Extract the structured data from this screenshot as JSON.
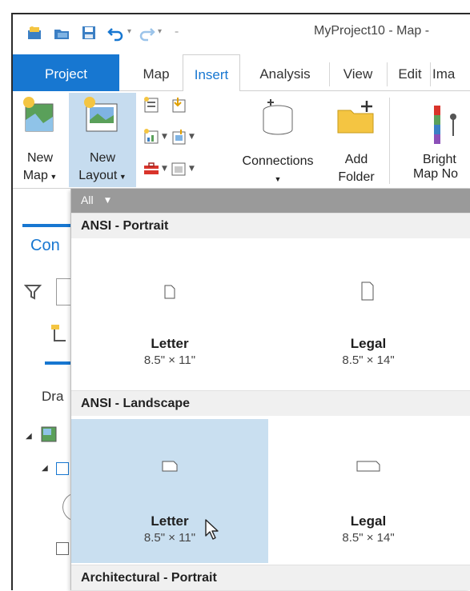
{
  "window": {
    "title": "MyProject10 - Map -"
  },
  "tabs": [
    {
      "label": "Project"
    },
    {
      "label": "Map"
    },
    {
      "label": "Insert"
    },
    {
      "label": "Analysis"
    },
    {
      "label": "View"
    },
    {
      "label": "Edit"
    },
    {
      "label": "Ima"
    }
  ],
  "ribbon": {
    "new_map": {
      "line1": "New",
      "line2": "Map"
    },
    "new_layout": {
      "line1": "New",
      "line2": "Layout"
    },
    "connections": {
      "label": "Connections"
    },
    "add_folder": {
      "line1": "Add",
      "line2": "Folder"
    },
    "basemap": {
      "line1": "Bright",
      "line2": "Map No"
    }
  },
  "dock": {
    "title": "Con",
    "tab_label": "Dra"
  },
  "gallery": {
    "filter": "All",
    "sections": [
      {
        "title": "ANSI - Portrait",
        "items": [
          {
            "name": "Letter",
            "size": "8.5\" × 11\""
          },
          {
            "name": "Legal",
            "size": "8.5\" × 14\""
          }
        ]
      },
      {
        "title": "ANSI - Landscape",
        "items": [
          {
            "name": "Letter",
            "size": "8.5\" × 11\""
          },
          {
            "name": "Legal",
            "size": "8.5\" × 14\""
          }
        ]
      },
      {
        "title": "Architectural - Portrait",
        "items": []
      }
    ]
  },
  "colors": {
    "accent": "#1777d1",
    "hover": "#c9dff0",
    "selected": "#c6dcef"
  }
}
